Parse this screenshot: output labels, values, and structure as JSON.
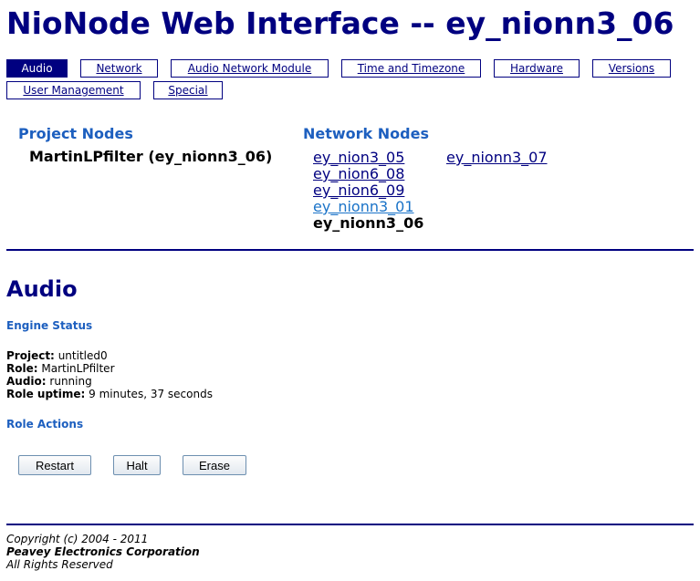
{
  "header": {
    "title": "NioNode Web Interface -- ey_nionn3_06"
  },
  "tabs": [
    {
      "label": "Audio",
      "active": true
    },
    {
      "label": "Network",
      "active": false
    },
    {
      "label": "Audio Network Module",
      "active": false
    },
    {
      "label": "Time and Timezone",
      "active": false
    },
    {
      "label": "Hardware",
      "active": false
    },
    {
      "label": "Versions",
      "active": false
    },
    {
      "label": "User Management",
      "active": false
    },
    {
      "label": "Special",
      "active": false
    }
  ],
  "project_nodes": {
    "heading": "Project Nodes",
    "items": [
      "MartinLPfilter (ey_nionn3_06)"
    ]
  },
  "network_nodes": {
    "heading": "Network Nodes",
    "links": [
      "ey_nion3_05",
      "ey_nion6_08",
      "ey_nion6_09",
      "ey_nionn3_01",
      "ey_nionn3_07"
    ],
    "current": "ey_nionn3_06"
  },
  "audio": {
    "title": "Audio",
    "engine_status": {
      "heading": "Engine Status",
      "project_label": "Project:",
      "project_value": "untitled0",
      "role_label": "Role:",
      "role_value": "MartinLPfilter",
      "audio_label": "Audio:",
      "audio_value": "running",
      "uptime_label": "Role uptime:",
      "uptime_value": "9 minutes, 37 seconds"
    },
    "role_actions": {
      "heading": "Role Actions",
      "restart_label": "Restart",
      "halt_label": "Halt",
      "erase_label": "Erase"
    }
  },
  "footer": {
    "copyright": "Copyright (c) 2004 - 2011",
    "company": "Peavey Electronics Corporation",
    "rights": "All Rights Reserved"
  },
  "colors": {
    "primary_navy": "#000080",
    "section_blue": "#1d5fbf",
    "visited_link": "#1a73c8"
  }
}
